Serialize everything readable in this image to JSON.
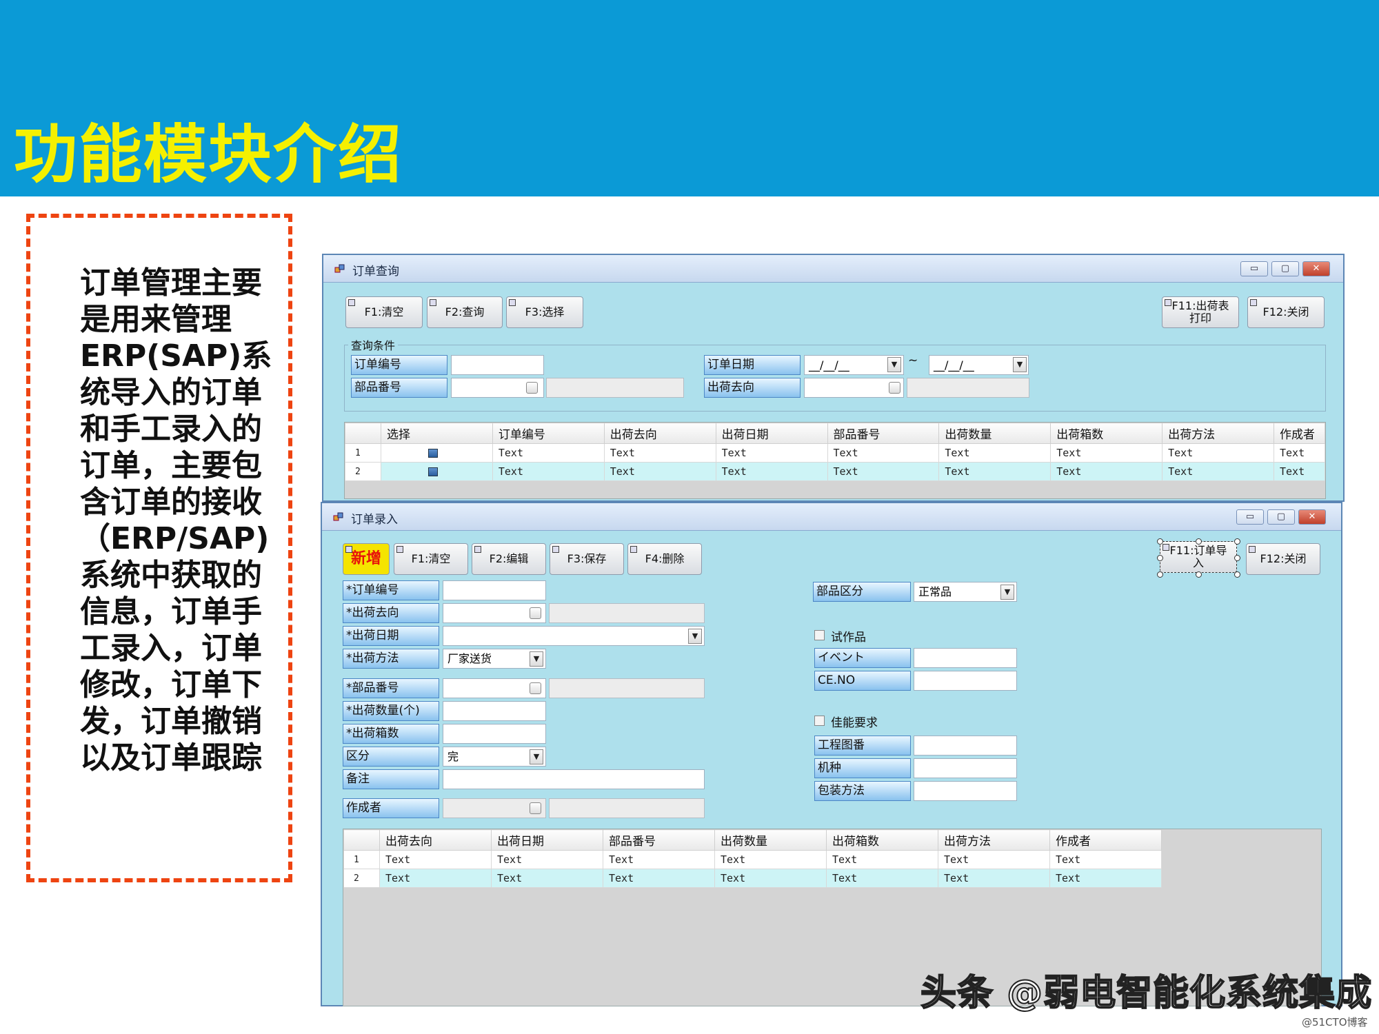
{
  "slide": {
    "title": "功能模块介绍",
    "description": "订单管理主要是用来管理ERP(SAP)系统导入的订单和手工录入的订单，主要包含订单的接收（ERP/SAP)系统中获取的信息，订单手工录入，订单修改，订单下发，订单撤销以及订单跟踪",
    "watermark": "头条 @弱电智能化系统集成",
    "copyright": "@51CTO博客"
  },
  "colors": {
    "banner": "#0b9ad6",
    "title": "#f5f000",
    "dashed_border": "#ee4411",
    "form_bg": "#aee0ec",
    "new_button": "#f5e400"
  },
  "query_window": {
    "title": "订单查询",
    "window_buttons": {
      "minimize": "▭",
      "maximize": "▢",
      "close": "✕"
    },
    "toolbar": {
      "clear": "F1:清空",
      "search": "F2:查询",
      "select": "F3:选择",
      "print_line1": "F11:出荷表",
      "print_line2": "打印",
      "close": "F12:关闭"
    },
    "criteria": {
      "group_label": "查询条件",
      "order_no_label": "订单编号",
      "part_no_label": "部品番号",
      "order_date_label": "订单日期",
      "date_from": "__/__/__",
      "date_to": "__/__/__",
      "date_sep": "~",
      "destination_label": "出荷去向"
    },
    "grid": {
      "columns": [
        "选择",
        "订单编号",
        "出荷去向",
        "出荷日期",
        "部品番号",
        "出荷数量",
        "出荷箱数",
        "出荷方法",
        "作成者"
      ],
      "rows": [
        {
          "num": "1",
          "cells": [
            "Text",
            "Text",
            "Text",
            "Text",
            "Text",
            "Text",
            "Text",
            "Text"
          ]
        },
        {
          "num": "2",
          "cells": [
            "Text",
            "Text",
            "Text",
            "Text",
            "Text",
            "Text",
            "Text",
            "Text"
          ]
        }
      ]
    }
  },
  "entry_window": {
    "title": "订单录入",
    "window_buttons": {
      "minimize": "▭",
      "maximize": "▢",
      "close": "✕"
    },
    "toolbar": {
      "new": "新增",
      "clear": "F1:清空",
      "edit": "F2:编辑",
      "save": "F3:保存",
      "delete": "F4:删除",
      "import_line1": "F11:订单导",
      "import_line2": "入",
      "close": "F12:关闭"
    },
    "left_fields": {
      "order_no": "*订单编号",
      "destination": "*出荷去向",
      "ship_date": "*出荷日期",
      "ship_method": "*出荷方法",
      "ship_method_value": "厂家送货",
      "part_no": "*部品番号",
      "quantity": "*出荷数量(个)",
      "boxes": "*出荷箱数",
      "category": "区分",
      "category_value": "完",
      "remarks": "备注",
      "creator": "作成者"
    },
    "right_fields": {
      "part_category": "部品区分",
      "part_category_value": "正常品",
      "trial_checkbox": "试作品",
      "event": "イベント",
      "ce_no": "CE.NO",
      "performance_checkbox": "佳能要求",
      "drawing_no": "工程图番",
      "model": "机种",
      "packing": "包装方法"
    },
    "grid": {
      "columns": [
        "出荷去向",
        "出荷日期",
        "部品番号",
        "出荷数量",
        "出荷箱数",
        "出荷方法",
        "作成者"
      ],
      "rows": [
        {
          "num": "1",
          "cells": [
            "Text",
            "Text",
            "Text",
            "Text",
            "Text",
            "Text",
            "Text"
          ]
        },
        {
          "num": "2",
          "cells": [
            "Text",
            "Text",
            "Text",
            "Text",
            "Text",
            "Text",
            "Text"
          ]
        }
      ]
    }
  }
}
